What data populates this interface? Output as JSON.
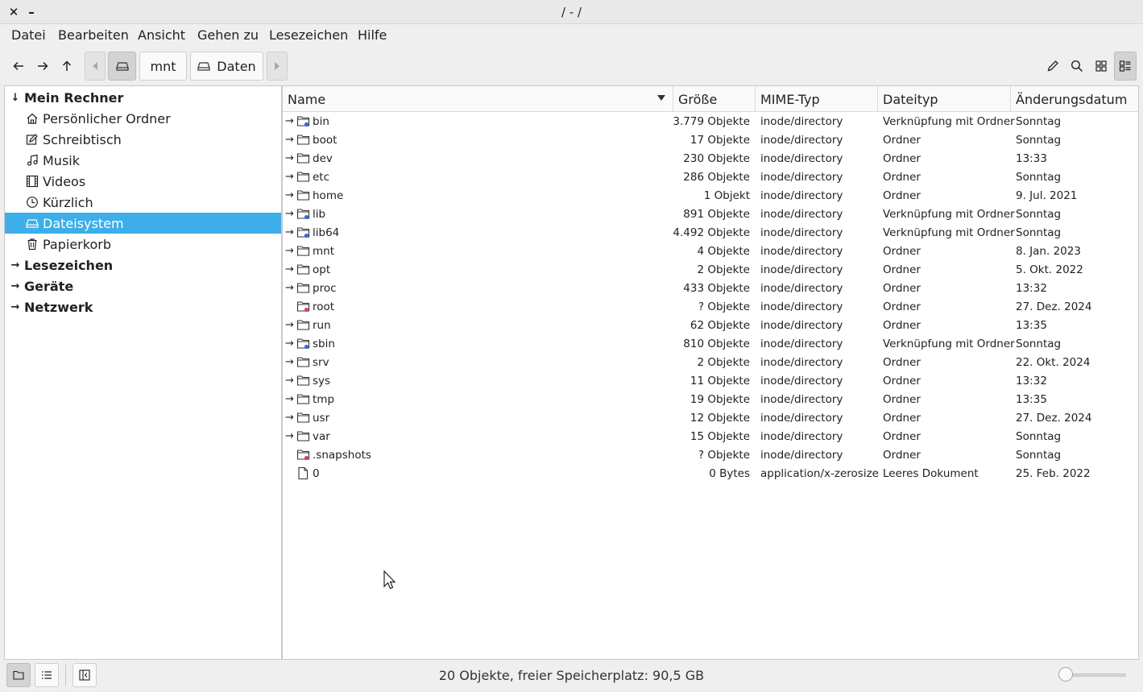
{
  "window": {
    "title": "/ - /",
    "close_glyph": "✕",
    "minimize_glyph": "–"
  },
  "menu": [
    "Datei",
    "Bearbeiten",
    "Ansicht",
    "Gehen zu",
    "Lesezeichen",
    "Hilfe"
  ],
  "toolbar": {
    "back_icon": "arrow-left-icon",
    "forward_icon": "arrow-right-icon",
    "up_icon": "arrow-up-icon",
    "breadcrumbs": [
      "mnt",
      "Daten"
    ],
    "right_icons": [
      "edit-icon",
      "search-icon",
      "icon-view-icon",
      "detail-view-icon"
    ]
  },
  "sidebar": {
    "sections": [
      {
        "label": "Mein Rechner",
        "expanded": true
      },
      {
        "label": "Lesezeichen",
        "expanded": false
      },
      {
        "label": "Geräte",
        "expanded": false
      },
      {
        "label": "Netzwerk",
        "expanded": false
      }
    ],
    "items": [
      {
        "label": "Persönlicher Ordner",
        "icon": "home-icon"
      },
      {
        "label": "Schreibtisch",
        "icon": "desktop-icon"
      },
      {
        "label": "Musik",
        "icon": "music-icon"
      },
      {
        "label": "Videos",
        "icon": "video-icon"
      },
      {
        "label": "Kürzlich",
        "icon": "clock-icon"
      },
      {
        "label": "Dateisystem",
        "icon": "drive-icon",
        "selected": true
      },
      {
        "label": "Papierkorb",
        "icon": "trash-icon"
      }
    ]
  },
  "columns": [
    "Name",
    "Größe",
    "MIME-Typ",
    "Dateityp",
    "Änderungsdatum"
  ],
  "files": [
    {
      "name": "bin",
      "size": "3.779 Objekte",
      "mime": "inode/directory",
      "type": "Verknüpfung mit Ordner",
      "date": "Sonntag",
      "kind": "link"
    },
    {
      "name": "boot",
      "size": "17 Objekte",
      "mime": "inode/directory",
      "type": "Ordner",
      "date": "Sonntag",
      "kind": "folder"
    },
    {
      "name": "dev",
      "size": "230 Objekte",
      "mime": "inode/directory",
      "type": "Ordner",
      "date": "13:33",
      "kind": "folder"
    },
    {
      "name": "etc",
      "size": "286 Objekte",
      "mime": "inode/directory",
      "type": "Ordner",
      "date": "Sonntag",
      "kind": "folder"
    },
    {
      "name": "home",
      "size": "1 Objekt",
      "mime": "inode/directory",
      "type": "Ordner",
      "date": "9. Jul. 2021",
      "kind": "folder"
    },
    {
      "name": "lib",
      "size": "891 Objekte",
      "mime": "inode/directory",
      "type": "Verknüpfung mit Ordner",
      "date": "Sonntag",
      "kind": "link"
    },
    {
      "name": "lib64",
      "size": "4.492 Objekte",
      "mime": "inode/directory",
      "type": "Verknüpfung mit Ordner",
      "date": "Sonntag",
      "kind": "link"
    },
    {
      "name": "mnt",
      "size": "4 Objekte",
      "mime": "inode/directory",
      "type": "Ordner",
      "date": "8. Jan. 2023",
      "kind": "folder"
    },
    {
      "name": "opt",
      "size": "2 Objekte",
      "mime": "inode/directory",
      "type": "Ordner",
      "date": "5. Okt. 2022",
      "kind": "folder"
    },
    {
      "name": "proc",
      "size": "433 Objekte",
      "mime": "inode/directory",
      "type": "Ordner",
      "date": "13:32",
      "kind": "folder"
    },
    {
      "name": "root",
      "size": "? Objekte",
      "mime": "inode/directory",
      "type": "Ordner",
      "date": "27. Dez. 2024",
      "kind": "locked"
    },
    {
      "name": "run",
      "size": "62 Objekte",
      "mime": "inode/directory",
      "type": "Ordner",
      "date": "13:35",
      "kind": "folder"
    },
    {
      "name": "sbin",
      "size": "810 Objekte",
      "mime": "inode/directory",
      "type": "Verknüpfung mit Ordner",
      "date": "Sonntag",
      "kind": "link"
    },
    {
      "name": "srv",
      "size": "2 Objekte",
      "mime": "inode/directory",
      "type": "Ordner",
      "date": "22. Okt. 2024",
      "kind": "folder"
    },
    {
      "name": "sys",
      "size": "11 Objekte",
      "mime": "inode/directory",
      "type": "Ordner",
      "date": "13:32",
      "kind": "folder"
    },
    {
      "name": "tmp",
      "size": "19 Objekte",
      "mime": "inode/directory",
      "type": "Ordner",
      "date": "13:35",
      "kind": "folder"
    },
    {
      "name": "usr",
      "size": "12 Objekte",
      "mime": "inode/directory",
      "type": "Ordner",
      "date": "27. Dez. 2024",
      "kind": "folder"
    },
    {
      "name": "var",
      "size": "15 Objekte",
      "mime": "inode/directory",
      "type": "Ordner",
      "date": "Sonntag",
      "kind": "folder"
    },
    {
      "name": ".snapshots",
      "size": "? Objekte",
      "mime": "inode/directory",
      "type": "Ordner",
      "date": "Sonntag",
      "kind": "locked"
    },
    {
      "name": "0",
      "size": "0 Bytes",
      "mime": "application/x-zerosize",
      "type": "Leeres Dokument",
      "date": "25. Feb. 2022",
      "kind": "file"
    }
  ],
  "status": {
    "text": "20 Objekte, freier Speicherplatz: 90,5 GB",
    "zoom_fraction": 0.0
  },
  "colors": {
    "accent": "#3daee9",
    "link_badge": "#2b6de0",
    "lock_badge": "#e0405a"
  }
}
